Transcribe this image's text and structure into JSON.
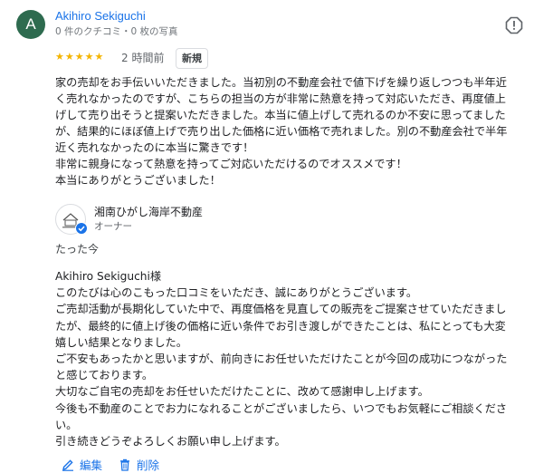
{
  "reviewer": {
    "initial": "A",
    "name": "Akihiro Sekiguchi",
    "meta": "0 件のクチコミ・0 枚の写真"
  },
  "review": {
    "stars": "★★★★★",
    "rating": 5,
    "time": "2 時間前",
    "badge": "新規",
    "lines": [
      "家の売却をお手伝いいただきました。当初別の不動産会社で値下げを繰り返しつつも半年近",
      "く売れなかったのですが、こちらの担当の方が非常に熱意を持って対応いただき、再度値上",
      "げして売り出そうと提案いただきました。本当に値上げして売れるのか不安に思ってました",
      "が、結果的にほぼ値上げで売り出した価格に近い価格で売れました。別の不動産会社で半年",
      "近く売れなかったのに本当に驚きです！",
      "非常に親身になって熱意を持ってご対応いただけるのでオススメです！",
      "本当にありがとうございました！"
    ]
  },
  "owner": {
    "name": "湘南ひがし海岸不動産",
    "role": "オーナー",
    "reply_time": "たった今",
    "reply_lines": [
      "Akihiro Sekiguchi様",
      "このたびは心のこもった口コミをいただき、誠にありがとうございます。",
      "ご売却活動が長期化していた中で、再度価格を見直しての販売をご提案させていただきまし",
      "たが、最終的に値上げ後の価格に近い条件でお引き渡しができたことは、私にとっても大変",
      "嬉しい結果となりました。",
      "ご不安もあったかと思いますが、前向きにお任せいただけたことが今回の成功につながった",
      "と感じております。",
      "大切なご自宅の売却をお任せいただけたことに、改めて感謝申し上げます。",
      "今後も不動産のことでお力になれることがございましたら、いつでもお気軽にご相談くださ",
      "い。",
      "引き続きどうぞよろしくお願い申し上げます。"
    ]
  },
  "actions": {
    "edit_label": "編集",
    "delete_label": "削除"
  },
  "colors": {
    "accent": "#1a73e8",
    "star": "#f4b400",
    "avatar_bg": "#2e6b4f",
    "verified": "#1a73e8"
  },
  "icons": [
    "report-icon",
    "verified-icon",
    "edit-icon",
    "delete-icon"
  ]
}
